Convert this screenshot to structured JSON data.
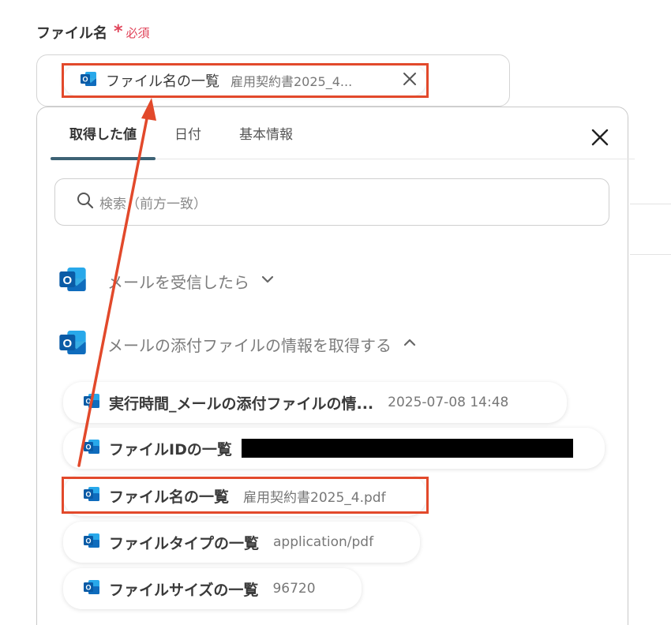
{
  "field": {
    "label": "ファイル名",
    "required_star": "*",
    "required_text": "必須"
  },
  "selected_chip": {
    "name": "ファイル名の一覧",
    "value": "雇用契約書2025_4...",
    "close_icon": "close-icon"
  },
  "tabs": [
    "取得した値",
    "日付",
    "基本情報"
  ],
  "search": {
    "placeholder": "検索（前方一致）"
  },
  "sections": [
    {
      "title": "メールを受信したら",
      "state": "collapsed",
      "icon": "outlook-icon"
    },
    {
      "title": "メールの添付ファイルの情報を取得する",
      "state": "expanded",
      "icon": "outlook-icon"
    }
  ],
  "items": [
    {
      "name": "実行時間_メールの添付ファイルの情...",
      "value": "2025-07-08 14:48"
    },
    {
      "name": "ファイルIDの一覧",
      "value": ""
    },
    {
      "name": "ファイル名の一覧",
      "value": "雇用契約書2025_4.pdf"
    },
    {
      "name": "ファイルタイプの一覧",
      "value": "application/pdf"
    },
    {
      "name": "ファイルサイズの一覧",
      "value": "96720"
    }
  ],
  "colors": {
    "accent_tab": "#3d6275",
    "highlight": "#e2492b",
    "required": "#e0445a",
    "outlook_blue": "#0f6cbd"
  }
}
